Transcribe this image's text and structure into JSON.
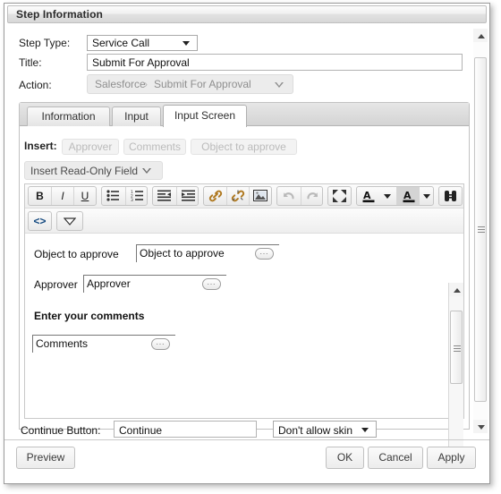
{
  "dialog": {
    "title": "Step Information"
  },
  "form": {
    "step_type_label": "Step Type:",
    "step_type_value": "Service Call",
    "title_label": "Title:",
    "title_value": "Submit For Approval",
    "action_label": "Action:",
    "action_app": "Salesforce",
    "action_separator": "›",
    "action_name": "Submit For Approval"
  },
  "tabs": [
    {
      "label": "Information",
      "active": false
    },
    {
      "label": "Input",
      "active": false
    },
    {
      "label": "Input Screen",
      "active": true
    }
  ],
  "insert": {
    "label": "Insert:",
    "chips": [
      "Approver",
      "Comments",
      "Object to approve"
    ],
    "readonly_field_label": "Insert Read-Only Field"
  },
  "toolbar": {
    "row1": [
      {
        "name": "bold",
        "glyph": "B"
      },
      {
        "name": "italic",
        "glyph": "I"
      },
      {
        "name": "underline",
        "glyph": "U"
      },
      {
        "name": "bullet-list",
        "glyph": ""
      },
      {
        "name": "numbered-list",
        "glyph": ""
      },
      {
        "name": "outdent",
        "glyph": ""
      },
      {
        "name": "indent",
        "glyph": ""
      },
      {
        "name": "insert-link",
        "glyph": ""
      },
      {
        "name": "remove-link",
        "glyph": ""
      },
      {
        "name": "insert-image",
        "glyph": ""
      },
      {
        "name": "undo",
        "glyph": ""
      },
      {
        "name": "redo",
        "glyph": ""
      },
      {
        "name": "fullscreen",
        "glyph": ""
      },
      {
        "name": "text-color",
        "glyph": "A"
      },
      {
        "name": "highlight-color",
        "glyph": "A"
      },
      {
        "name": "find-replace",
        "glyph": ""
      }
    ],
    "row2": [
      {
        "name": "source-code",
        "glyph": "<>"
      },
      {
        "name": "more-options",
        "glyph": ""
      }
    ]
  },
  "editor_content": {
    "lines": [
      {
        "label": "Object to approve",
        "field_value": "Object to approve"
      },
      {
        "label": "Approver",
        "field_value": "Approver"
      },
      {
        "label": "Enter your comments",
        "field_value": "Comments"
      }
    ]
  },
  "continue_row": {
    "label": "Continue Button:",
    "value": "Continue",
    "skin_value": "Don't allow skin"
  },
  "footer": {
    "preview": "Preview",
    "ok": "OK",
    "cancel": "Cancel",
    "apply": "Apply"
  }
}
